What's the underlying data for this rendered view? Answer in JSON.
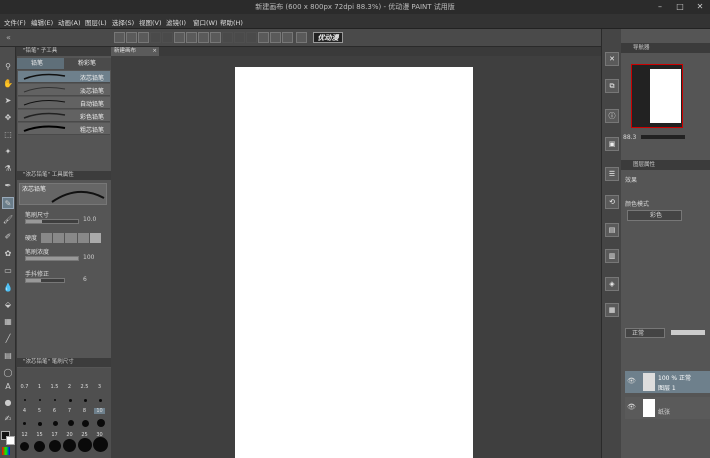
{
  "window": {
    "title": "新建画布 (600 x 800px 72dpi 88.3%) - 优动漫 PAINT 试用版"
  },
  "menu": [
    "文件(F)",
    "编辑(E)",
    "动画(A)",
    "图层(L)",
    "选择(S)",
    "视图(V)",
    "滤镜(I)",
    "窗口(W)",
    "帮助(H)"
  ],
  "toolbar": {
    "logo": "优动漫"
  },
  "subtool": {
    "header": "\"铅笔\" 子工具",
    "tabs": [
      "铅笔",
      "粉彩笔"
    ],
    "brushes": [
      "浓芯铅笔",
      "淡芯铅笔",
      "自动铅笔",
      "彩色铅笔",
      "粗芯铅笔"
    ]
  },
  "toolprop": {
    "header": "\"浓芯铅笔\" 工具属性",
    "name": "浓芯铅笔",
    "size_label": "笔刷尺寸",
    "size_value": "10.0",
    "texture_label": "硬度",
    "density_label": "笔刷浓度",
    "density_value": "100",
    "stab_label": "手抖修正",
    "stab_value": "6"
  },
  "brushsize": {
    "header": "\"浓芯铅笔\" 笔刷尺寸",
    "sizes": [
      "0.7",
      "1",
      "1.5",
      "2",
      "2.5",
      "3",
      "4",
      "5",
      "6",
      "7",
      "8",
      "10",
      "12",
      "15",
      "17",
      "20",
      "25",
      "30"
    ]
  },
  "canvas": {
    "doc_tab": "新建画布"
  },
  "navigator": {
    "header": "导航器",
    "zoom": "88.3"
  },
  "layerprop": {
    "header": "图层属性",
    "effect_label": "效果",
    "mode_label": "颜色模式",
    "mode_value": "彩色"
  },
  "layers": {
    "blend": "正常",
    "items": [
      {
        "opacity": "100 %",
        "mode": "正常",
        "name": "图层 1"
      },
      {
        "name": "纸张"
      }
    ]
  }
}
